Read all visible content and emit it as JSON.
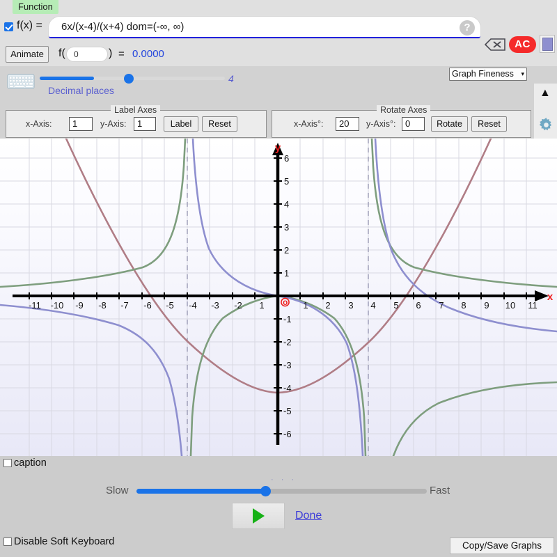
{
  "header": {
    "function_tag": "Function",
    "fx_label": "f(x) =",
    "fx_value": "6x/(x-4)/(x+4)   dom=(-∞, ∞)",
    "help_glyph": "?",
    "ac_label": "AC",
    "animate_label": "Animate",
    "f_open": "f(",
    "f_arg_value": "0",
    "f_close": ")",
    "f_equals": "=",
    "f_result": "0.0000",
    "decimal_places_label": "Decimal places",
    "decimal_places_value": "4",
    "graph_fineness_label": "Graph Fineness",
    "graph_fineness_caret": "⌄"
  },
  "label_axes": {
    "legend": "Label Axes",
    "x_label": "x-Axis:",
    "x_value": "1",
    "y_label": "y-Axis:",
    "y_value": "1",
    "label_button": "Label",
    "reset_button": "Reset"
  },
  "rotate_axes": {
    "legend": "Rotate Axes",
    "x_label": "x-Axis°:",
    "x_value": "20",
    "y_label": "y-Axis°:",
    "y_value": "0",
    "rotate_button": "Rotate",
    "reset_button": "Reset"
  },
  "bottom": {
    "caption_label": "caption",
    "slow_label": "Slow",
    "fast_label": "Fast",
    "dots": "· · ·",
    "done_label": "Done",
    "disable_keyboard_label": "Disable Soft Keyboard",
    "copy_save_label": "Copy/Save Graphs"
  },
  "colors": {
    "accent_blue": "#1a73e8",
    "ac_red": "#f52a2a",
    "function_tag_green": "#b6ecb6",
    "curve_green": "#7e9e7e",
    "curve_purple": "#8e8fcf",
    "curve_rose": "#b07d86",
    "axis_label_red": "#ee2222"
  },
  "chart_data": {
    "type": "line",
    "title": "",
    "xlabel": "x",
    "ylabel": "y",
    "xlim": [
      -11.8,
      11.8
    ],
    "ylim": [
      -6.8,
      6.4
    ],
    "grid": true,
    "x_ticks": [
      -11,
      -10,
      -9,
      -8,
      -7,
      -6,
      -5,
      -4,
      -3,
      -2,
      -1,
      1,
      2,
      3,
      4,
      5,
      6,
      7,
      8,
      9,
      10,
      11
    ],
    "x_tick_labels": [
      "-11",
      "-10",
      "-9",
      "-8",
      "-7",
      "-6",
      "-5",
      "-4",
      "-3",
      "-2",
      "1",
      "1",
      "2",
      "3",
      "4",
      "5",
      "6",
      "7",
      "8",
      "9",
      "10",
      "11"
    ],
    "y_ticks": [
      -6,
      -5,
      -4,
      -3,
      -2,
      -1,
      1,
      2,
      3,
      4,
      5,
      6
    ],
    "y_tick_labels": [
      "-6",
      "-5",
      "-4",
      "-3",
      "-2",
      "-1",
      "1",
      "2",
      "3",
      "4",
      "5",
      "6"
    ],
    "origin_label": "o",
    "asymptotes": [
      -4,
      4
    ],
    "series": [
      {
        "name": "f(x) = 6x/(x-4)/(x+4)",
        "color": "#8e8fcf",
        "expression": "6*x/((x-4)*(x+4))",
        "vertical_asymptotes": [
          -4,
          4
        ]
      },
      {
        "name": "secondary-green-curve",
        "color": "#7e9e7e",
        "expression": "tan-like branches with asymptotes at -4 and 4"
      },
      {
        "name": "secondary-rose-curve",
        "color": "#b07d86",
        "expression": "parabola-like, vertex near (0,-4.2)"
      }
    ]
  }
}
